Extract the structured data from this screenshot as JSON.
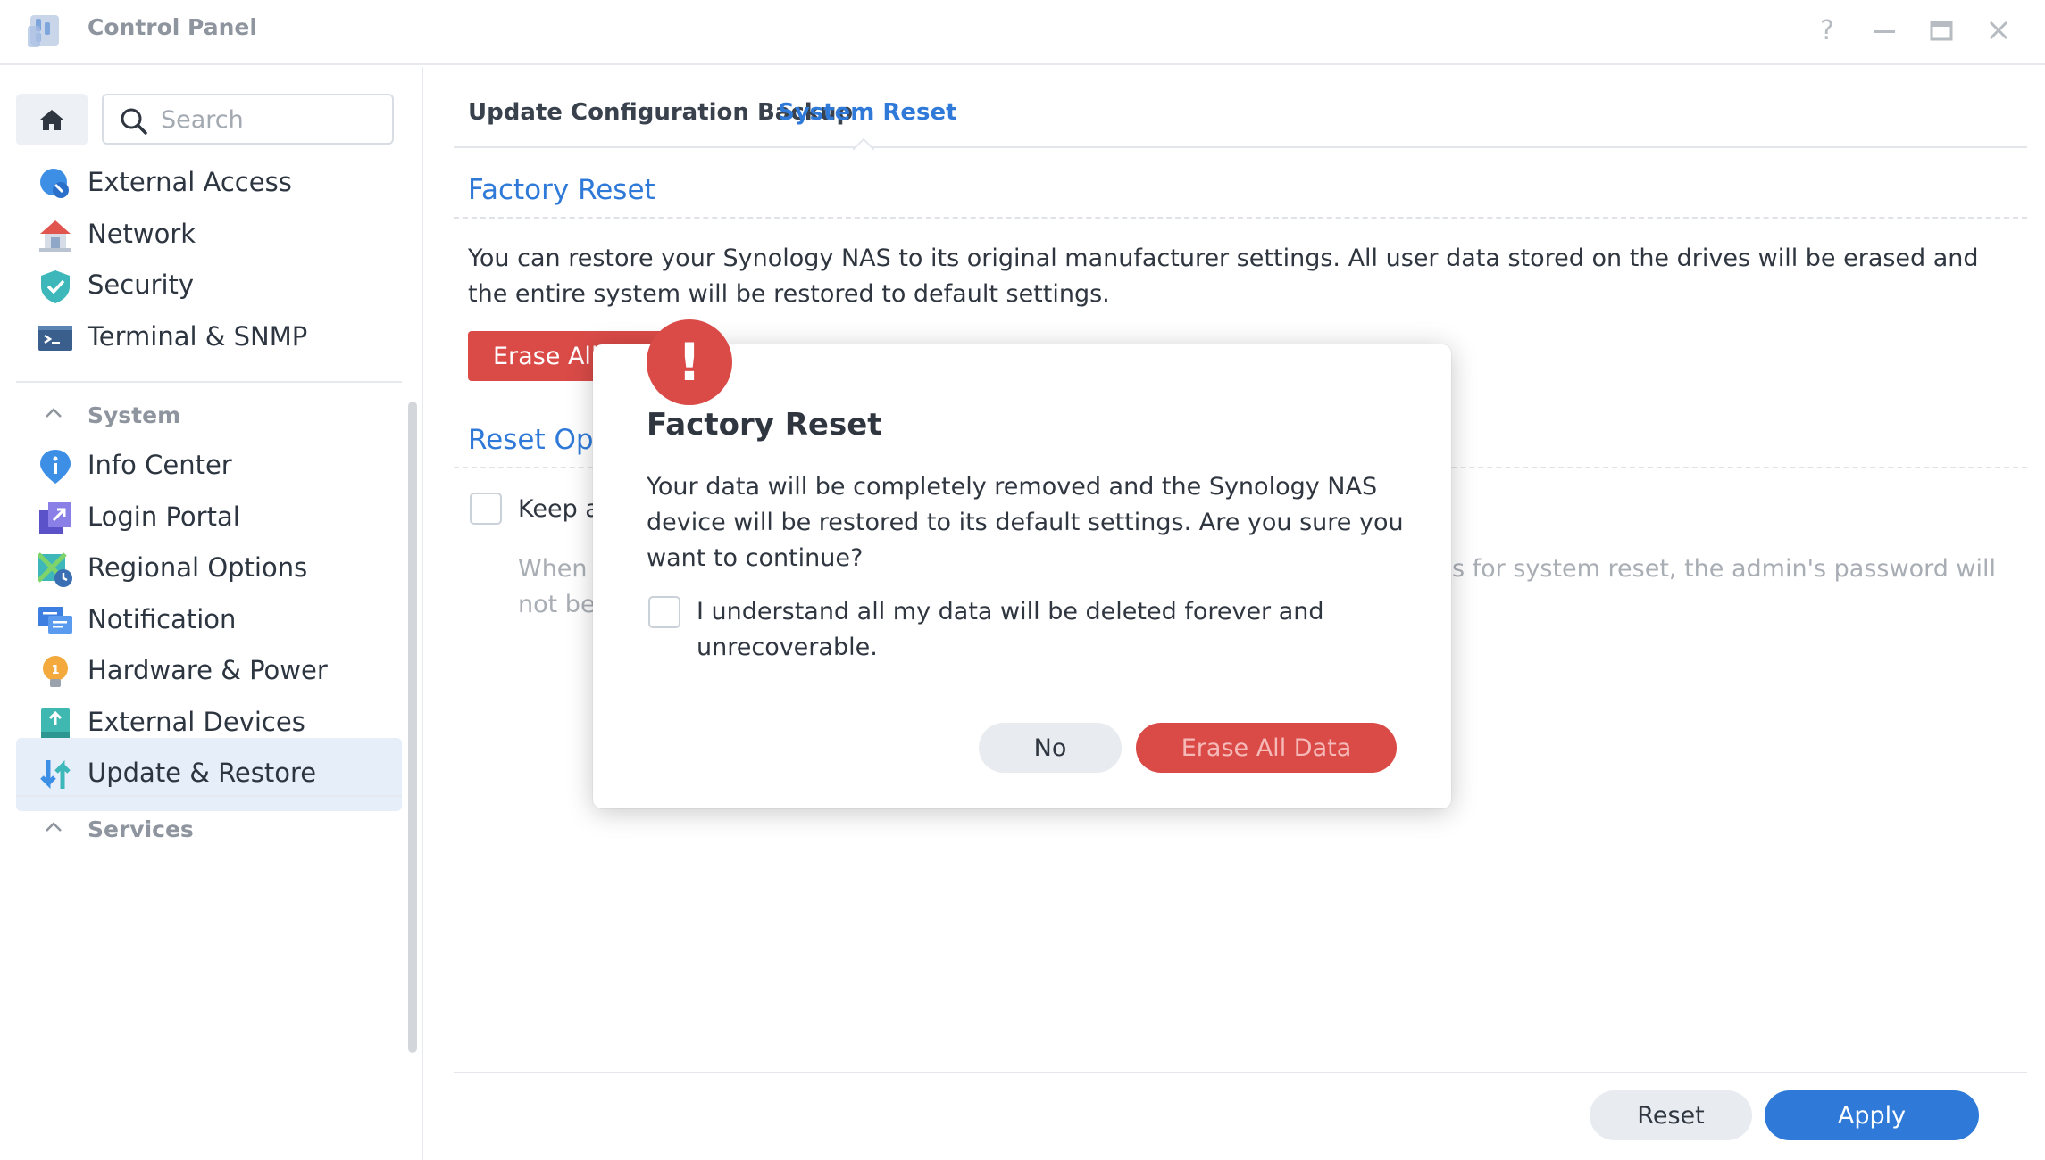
{
  "window": {
    "title": "Control Panel",
    "icons": [
      "control-panel-icon",
      "help-icon",
      "minimize-icon",
      "maximize-icon",
      "close-icon"
    ]
  },
  "sidebar": {
    "search_placeholder": "Search",
    "items_top": [
      {
        "label": "External Access",
        "icon": "external-access-icon"
      },
      {
        "label": "Network",
        "icon": "network-icon"
      },
      {
        "label": "Security",
        "icon": "security-icon"
      },
      {
        "label": "Terminal & SNMP",
        "icon": "terminal-icon"
      }
    ],
    "section_system": "System",
    "items_system": [
      {
        "label": "Info Center",
        "icon": "info-center-icon"
      },
      {
        "label": "Login Portal",
        "icon": "login-portal-icon"
      },
      {
        "label": "Regional Options",
        "icon": "regional-options-icon"
      },
      {
        "label": "Notification",
        "icon": "notification-icon"
      },
      {
        "label": "Hardware & Power",
        "icon": "hardware-power-icon"
      },
      {
        "label": "External Devices",
        "icon": "external-devices-icon"
      },
      {
        "label": "Update & Restore",
        "icon": "update-restore-icon",
        "active": true
      }
    ],
    "section_services": "Services"
  },
  "tabs": [
    {
      "label": "Update",
      "active": false
    },
    {
      "label": "Configuration Backup",
      "active": false
    },
    {
      "label": "System Reset",
      "active": true
    }
  ],
  "factory_reset": {
    "title": "Factory Reset",
    "description": "You can restore your Synology NAS to its original manufacturer settings. All user data stored on the drives will be erased and the entire system will be restored to default settings.",
    "erase_button": "Erase All Data"
  },
  "reset_options": {
    "title": "Reset Options",
    "keep_label": "Keep a",
    "note_left_1": "When",
    "note_left_2": "not be",
    "note_right": "s for system reset, the admin's password will"
  },
  "footer": {
    "reset_label": "Reset",
    "apply_label": "Apply"
  },
  "dialog": {
    "badge": "!",
    "title": "Factory Reset",
    "message": "Your data will be completely removed and the Synology NAS device will be restored to its default settings. Are you sure you want to continue?",
    "checkbox_label": "I understand all my data will be deleted forever and unrecoverable.",
    "checkbox_checked": false,
    "no_label": "No",
    "erase_label": "Erase All Data"
  },
  "colors": {
    "accent": "#2f7ad8",
    "danger": "#da4b48",
    "active_bg": "#e6eef9"
  }
}
